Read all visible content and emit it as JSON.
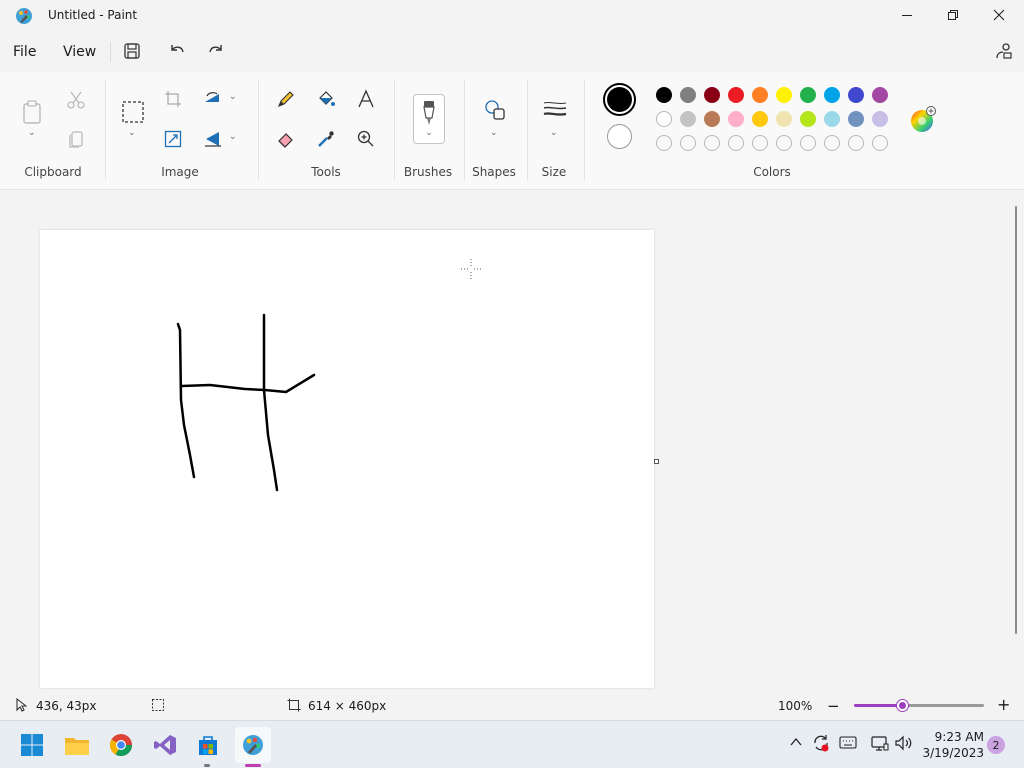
{
  "window": {
    "title": "Untitled - Paint",
    "icon": "paint-app-icon"
  },
  "menu": {
    "file_label": "File",
    "view_label": "View"
  },
  "ribbon": {
    "groups": {
      "clipboard": "Clipboard",
      "image": "Image",
      "tools": "Tools",
      "brushes": "Brushes",
      "shapes": "Shapes",
      "size": "Size",
      "colors": "Colors"
    },
    "primary_color": "#000000",
    "secondary_color": "#ffffff",
    "palette_row1": [
      "#000000",
      "#7f7f7f",
      "#880015",
      "#ed1c24",
      "#ff7f27",
      "#fff200",
      "#22b14c",
      "#00a2e8",
      "#3f48cc",
      "#a349a4"
    ],
    "palette_row2": [
      "#ffffff",
      "#c3c3c3",
      "#b97a57",
      "#ffaec9",
      "#ffc90e",
      "#efe4b0",
      "#b5e61d",
      "#99d9ea",
      "#7092be",
      "#c8bfe7"
    ],
    "palette_row3_empty_count": 10
  },
  "status": {
    "cursor_position": "436, 43px",
    "canvas_size": "614 × 460px",
    "zoom": "100%",
    "zoom_fraction": 0.38
  },
  "taskbar": {
    "apps": [
      "start-icon",
      "file-explorer-icon",
      "chrome-icon",
      "visual-studio-icon",
      "microsoft-store-icon",
      "paint-icon"
    ],
    "time": "9:23 AM",
    "date": "3/19/2023",
    "notification_count": "2"
  }
}
